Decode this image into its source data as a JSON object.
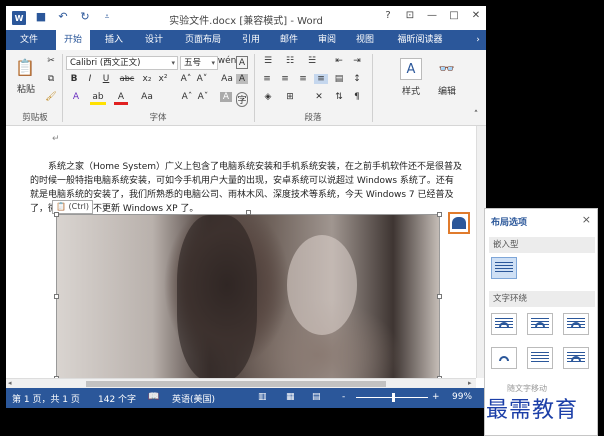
{
  "titlebar": {
    "app_icon": "W",
    "title": "实验文件.docx [兼容模式] - Word",
    "qat": [
      "save-icon",
      "undo-icon",
      "redo-icon",
      "customize-icon"
    ],
    "controls": [
      "?",
      "restore-ribbon-icon",
      "minimize-icon",
      "maximize-icon",
      "close-icon"
    ]
  },
  "tabs": [
    "文件",
    "开始",
    "插入",
    "设计",
    "页面布局",
    "引用",
    "邮件",
    "审阅",
    "视图",
    "福昕阅读器"
  ],
  "active_tab": "开始",
  "ribbon": {
    "clipboard": {
      "paste_label": "粘贴",
      "group": "剪贴板"
    },
    "font": {
      "font_name": "Calibri (西文正文)",
      "font_size": "五号",
      "group": "字体",
      "bold": "B",
      "italic": "I",
      "underline": "U",
      "strike": "abc",
      "subscript": "x₂",
      "superscript": "x²",
      "grow": "A˄",
      "shrink": "A˅",
      "case": "Aa",
      "clear": "A"
    },
    "paragraph": {
      "group": "段落"
    },
    "styles": {
      "label": "样式"
    },
    "editing": {
      "label": "编辑"
    }
  },
  "document": {
    "paragraph": "系统之家（Home System）广义上包含了电脑系统安装和手机系统安装，在之前手机软件还不是很普及的时候一般特指电脑系统安装，可如今手机用户大量的出现，安卓系统可以说超过 Windows 系统了。还有就是电脑系统的安装了，我们所熟悉的电脑公司、雨林木风、深度技术等系统，今天 Windows 7 已经普及了，微软也宣布不更新 Windows XP 了。",
    "paste_options": "(Ctrl)"
  },
  "status": {
    "page": "第 1 页，共 1 页",
    "words": "142 个字",
    "language": "英语(美国)",
    "zoom": "99%",
    "zoom_minus": "-",
    "zoom_plus": "+"
  },
  "layout_pane": {
    "title": "布局选项",
    "close": "×",
    "inline_section": "嵌入型",
    "wrap_section": "文字环绕",
    "obscured_text": "随文字移动"
  },
  "watermark": "最需教育"
}
